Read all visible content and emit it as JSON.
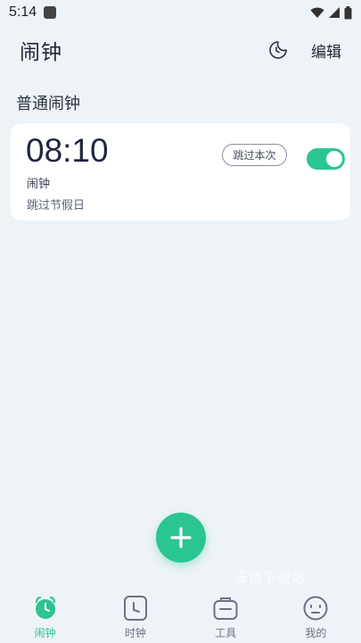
{
  "status_bar": {
    "time": "5:14"
  },
  "header": {
    "title": "闹钟",
    "edit_label": "编辑",
    "moon_icon": "moon-clock-icon"
  },
  "section": {
    "title": "普通闹钟"
  },
  "alarm": {
    "time": "08:10",
    "name": "闹钟",
    "repeat": "跳过节假日",
    "skip_label": "跳过本次",
    "enabled": true
  },
  "fab": {
    "icon": "plus-icon"
  },
  "watermark": "沃德下载站",
  "nav": {
    "items": [
      {
        "label": "闹钟",
        "icon": "alarm-clock-icon",
        "active": true
      },
      {
        "label": "时钟",
        "icon": "clock-icon",
        "active": false
      },
      {
        "label": "工具",
        "icon": "toolbox-icon",
        "active": false
      },
      {
        "label": "我的",
        "icon": "profile-face-icon",
        "active": false
      }
    ]
  },
  "colors": {
    "accent": "#2bc591",
    "background": "#eef3f8",
    "card": "#ffffff"
  }
}
